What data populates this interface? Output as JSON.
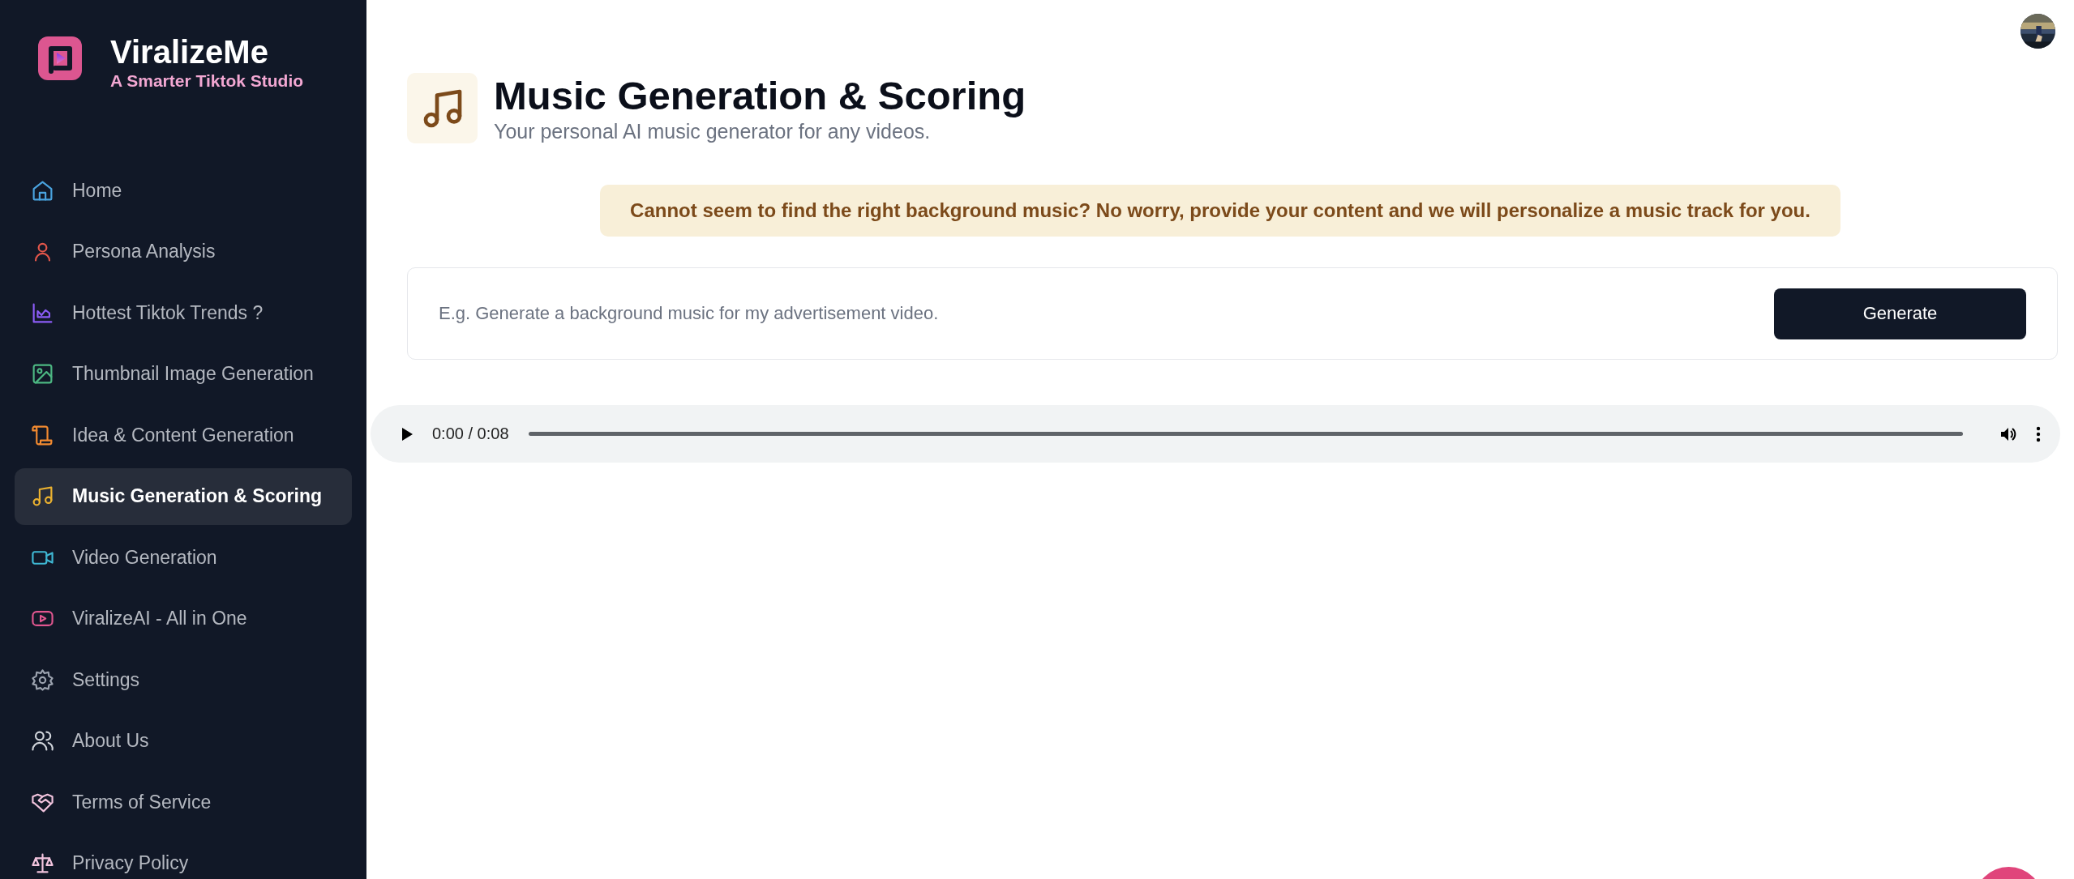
{
  "brand": {
    "name": "ViralizeMe",
    "tagline": "A Smarter Tiktok Studio"
  },
  "nav": [
    {
      "label": "Home",
      "selected": false
    },
    {
      "label": "Persona Analysis",
      "selected": false
    },
    {
      "label": "Hottest Tiktok Trends ?",
      "selected": false
    },
    {
      "label": "Thumbnail Image Generation",
      "selected": false
    },
    {
      "label": "Idea & Content Generation",
      "selected": false
    },
    {
      "label": "Music Generation & Scoring",
      "selected": true
    },
    {
      "label": "Video Generation",
      "selected": false
    },
    {
      "label": "ViralizeAI - All in One",
      "selected": false
    },
    {
      "label": "Settings",
      "selected": false
    },
    {
      "label": "About Us",
      "selected": false
    },
    {
      "label": "Terms of Service",
      "selected": false
    },
    {
      "label": "Privacy Policy",
      "selected": false
    }
  ],
  "header": {
    "title": "Music Generation & Scoring",
    "subtitle": "Your personal AI music generator for any videos."
  },
  "banner": "Cannot seem to find the right background music? No worry, provide your content and we will personalize a music track for you.",
  "prompt": {
    "placeholder": "E.g. Generate a background music for my advertisement video.",
    "button": "Generate"
  },
  "player": {
    "time": "0:00 / 0:08"
  }
}
